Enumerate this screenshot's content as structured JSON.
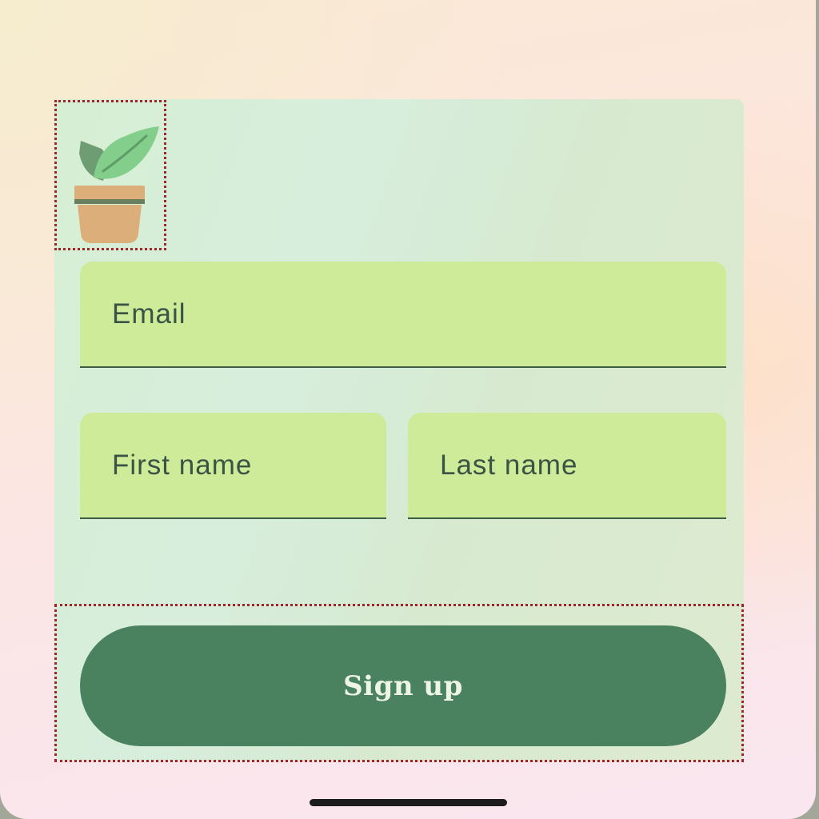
{
  "form": {
    "logo_icon": "potted-plant-icon",
    "email": {
      "label": "Email",
      "value": ""
    },
    "first_name": {
      "label": "First name",
      "value": ""
    },
    "last_name": {
      "label": "Last name",
      "value": ""
    },
    "submit_label": "Sign up"
  },
  "colors": {
    "field_fill": "#cdeb98",
    "button": "#4a8260",
    "button_text": "#eef4e6",
    "label_text": "#3b5344",
    "highlight_outline": "#a3232a"
  }
}
